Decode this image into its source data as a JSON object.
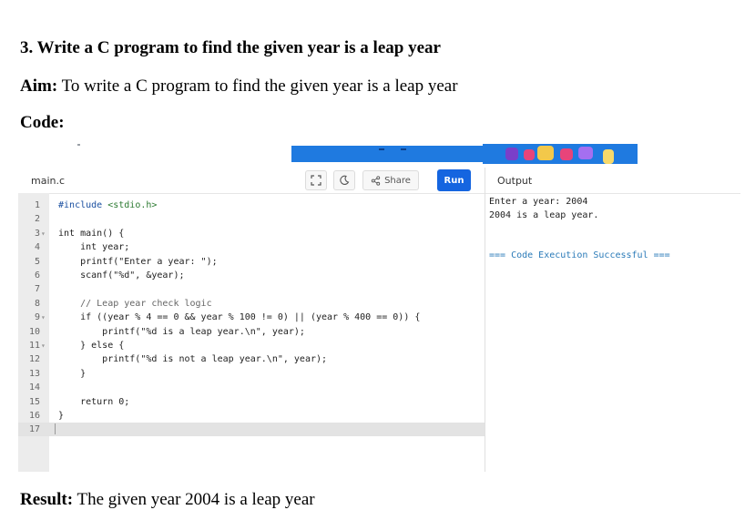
{
  "document": {
    "heading": "3.  Write a C program to find the given year is a leap year",
    "aim_label": "Aim:",
    "aim_text": " To write a C program to find the given year is a leap year",
    "code_label": "Code:",
    "result_label": "Result:",
    "result_text": " The given year 2004 is a leap year"
  },
  "editor": {
    "tab": "main.c",
    "share_label": "Share",
    "run_label": "Run",
    "output_label": "Output",
    "lines": [
      {
        "n": "1",
        "fold": "",
        "code": " #include <stdio.h>"
      },
      {
        "n": "2",
        "fold": "",
        "code": ""
      },
      {
        "n": "3",
        "fold": "▾",
        "code": " int main() {"
      },
      {
        "n": "4",
        "fold": "",
        "code": "     int year;"
      },
      {
        "n": "5",
        "fold": "",
        "code": "     printf(\"Enter a year: \");"
      },
      {
        "n": "6",
        "fold": "",
        "code": "     scanf(\"%d\", &year);"
      },
      {
        "n": "7",
        "fold": "",
        "code": ""
      },
      {
        "n": "8",
        "fold": "",
        "code": "     // Leap year check logic"
      },
      {
        "n": "9",
        "fold": "▾",
        "code": "     if ((year % 4 == 0 && year % 100 != 0) || (year % 400 == 0)) {"
      },
      {
        "n": "10",
        "fold": "",
        "code": "         printf(\"%d is a leap year.\\n\", year);"
      },
      {
        "n": "11",
        "fold": "▾",
        "code": "     } else {"
      },
      {
        "n": "12",
        "fold": "",
        "code": "         printf(\"%d is not a leap year.\\n\", year);"
      },
      {
        "n": "13",
        "fold": "",
        "code": "     }"
      },
      {
        "n": "14",
        "fold": "",
        "code": ""
      },
      {
        "n": "15",
        "fold": "",
        "code": "     return 0;"
      },
      {
        "n": "16",
        "fold": "",
        "code": " }"
      },
      {
        "n": "17",
        "fold": "",
        "code": ""
      }
    ]
  },
  "output": {
    "line1": "Enter a year: 2004",
    "line2": "2004 is a leap year.",
    "success": "=== Code Execution Successful ==="
  },
  "icons": {
    "fullscreen": "fullscreen-icon",
    "theme": "theme-toggle-icon",
    "share": "share-icon"
  },
  "colors": {
    "run_button": "#1565e0",
    "success_text": "#2a7ab8"
  }
}
